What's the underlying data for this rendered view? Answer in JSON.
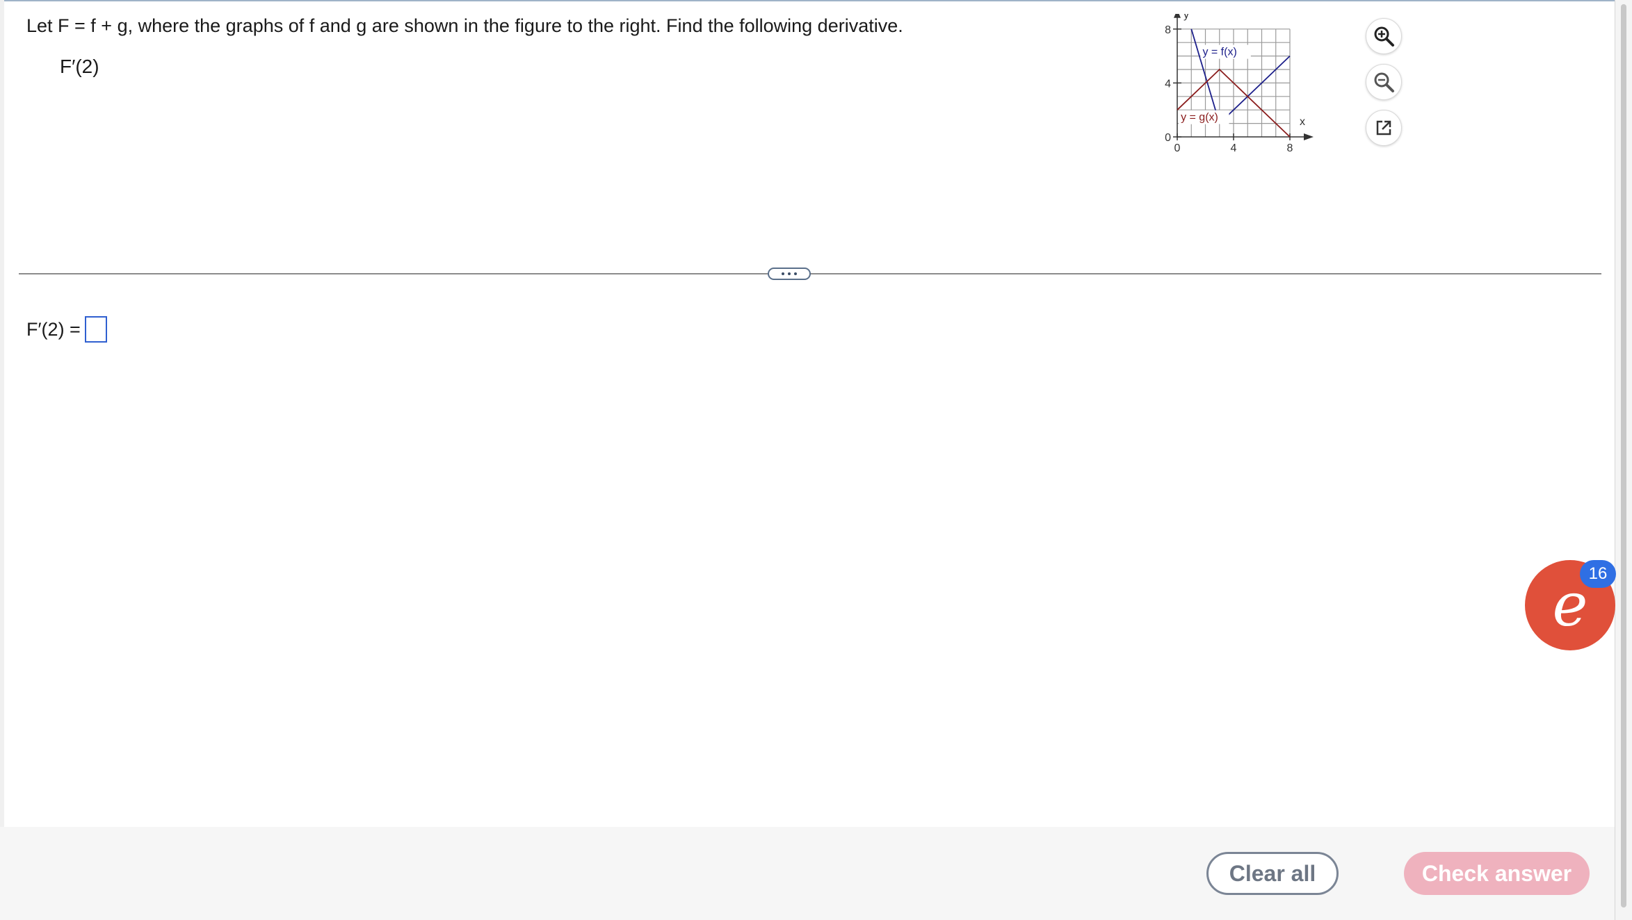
{
  "question": {
    "prompt": "Let F = f + g, where the graphs of f and g are shown in the figure to the right. Find the following derivative.",
    "expression": "F′(2)"
  },
  "answer": {
    "label": "F′(2) =",
    "value": ""
  },
  "figure": {
    "axis_label_x": "x",
    "axis_label_y": "y",
    "x_ticks": [
      "0",
      "4",
      "8"
    ],
    "y_ticks": [
      "0",
      "4",
      "8"
    ],
    "f_label": "y = f(x)",
    "g_label": "y = g(x)",
    "colors": {
      "f": "#1c1f8a",
      "g": "#8a1c1c",
      "grid": "#9a9a9a"
    }
  },
  "chart_data": {
    "type": "line",
    "xlim": [
      0,
      8
    ],
    "ylim": [
      0,
      8
    ],
    "grid": true,
    "series": [
      {
        "name": "y = f(x)",
        "x": [
          1,
          3,
          8
        ],
        "y": [
          8,
          1,
          6
        ]
      },
      {
        "name": "y = g(x)",
        "x": [
          0,
          3,
          8
        ],
        "y": [
          2,
          5,
          0
        ]
      }
    ]
  },
  "tools": {
    "zoom_in": "zoom-in-icon",
    "zoom_out": "zoom-out-icon",
    "popout": "external-link-icon"
  },
  "more_button": "more-icon",
  "helper": {
    "glyph": "e",
    "badge": "16"
  },
  "footer": {
    "clear_label": "Clear all",
    "check_label": "Check answer"
  }
}
